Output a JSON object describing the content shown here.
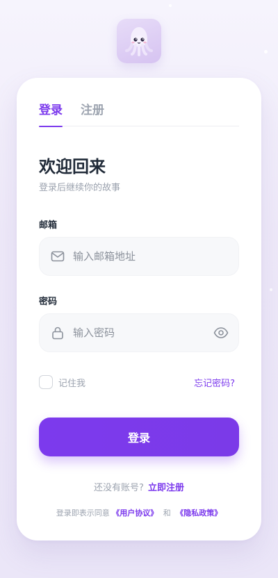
{
  "logo": {
    "icon": "squid-mascot-icon"
  },
  "tabs": [
    {
      "label": "登录",
      "active": true
    },
    {
      "label": "注册",
      "active": false
    }
  ],
  "heading": {
    "title": "欢迎回来",
    "subtitle": "登录后继续你的故事"
  },
  "email": {
    "label": "邮箱",
    "placeholder": "输入邮箱地址",
    "value": "",
    "icon": "mail-icon"
  },
  "password": {
    "label": "密码",
    "placeholder": "输入密码",
    "value": "",
    "icon": "lock-icon",
    "toggle_icon": "eye-icon"
  },
  "remember": {
    "label": "记住我",
    "checked": false
  },
  "forgot_label": "忘记密码?",
  "submit_label": "登录",
  "signup": {
    "prompt": "还没有账号?",
    "link": "立即注册"
  },
  "terms": {
    "prefix": "登录即表示同意",
    "user_agreement": "《用户协议》",
    "and": "和",
    "privacy_policy": "《隐私政策》"
  },
  "colors": {
    "accent": "#7c3aed",
    "text_dark": "#1f2937",
    "text_muted": "#9ca3af",
    "input_bg": "#f7f8fa"
  }
}
